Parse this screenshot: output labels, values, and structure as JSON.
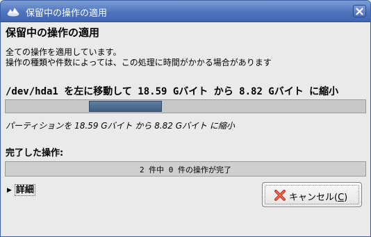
{
  "window": {
    "title": "保留中の操作の適用"
  },
  "main": {
    "heading": "保留中の操作の適用",
    "description_line1": "全ての操作を適用しています。",
    "description_line2": "操作の種類や件数によっては、この処理に時間がかかる場合があります",
    "current_operation": "/dev/hda1 を左に移動して 18.59 Gバイト から 8.82 Gバイト に縮小",
    "sub_operation": "パーティションを 18.59 Gバイト から 8.82 Gバイト に縮小",
    "completed_label": "完了した操作:",
    "completed_status": "2 件中 0 件の操作が完了",
    "completed_fraction": 0,
    "details_label": "詳細"
  },
  "buttons": {
    "cancel_label": "キャンセル(",
    "cancel_mnemonic": "C",
    "cancel_suffix": ")"
  },
  "colors": {
    "titlebar": "#4e74bd",
    "progress_fill": "#4f6e92",
    "cancel_icon": "#e03020"
  }
}
